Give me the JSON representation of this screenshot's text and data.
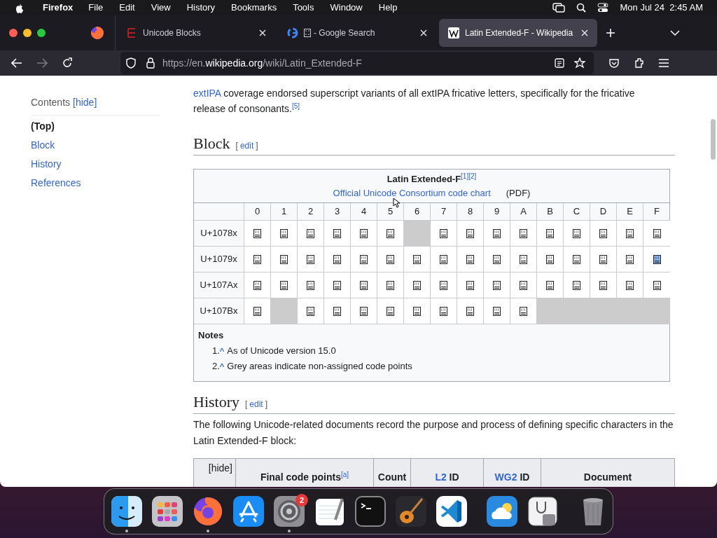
{
  "menu_bar": {
    "app": "Firefox",
    "items": [
      "File",
      "Edit",
      "View",
      "History",
      "Bookmarks",
      "Tools",
      "Window",
      "Help"
    ],
    "clock": "Mon Jul 24  2:45 AM"
  },
  "tabs": [
    {
      "title": "Unicode Blocks",
      "kind": "unicode",
      "selected": false
    },
    {
      "title": "- Google Search",
      "kind": "google",
      "selected": false
    },
    {
      "title": "Latin Extended-F - Wikipedia",
      "kind": "wikipedia",
      "selected": true
    }
  ],
  "url": {
    "scheme": "https://en.",
    "host": "wikipedia.org",
    "path": "/wiki/Latin_Extended-F"
  },
  "sidebar": {
    "title": "Contents",
    "toggle": "[hide]",
    "items": [
      {
        "label": "(Top)",
        "selected": true
      },
      {
        "label": "Block",
        "selected": false
      },
      {
        "label": "History",
        "selected": false
      },
      {
        "label": "References",
        "selected": false
      }
    ]
  },
  "intro": {
    "paragraph": [
      {
        "text": "extIPA",
        "kind": "link"
      },
      {
        "text": " coverage endorsed superscript variants of all extIPA fricative letters, specifically for the fricative release of consonants.",
        "kind": "text"
      },
      {
        "text": "[5]",
        "kind": "ref"
      }
    ]
  },
  "block_section": {
    "heading": "Block",
    "edit_open": "[",
    "edit": "edit",
    "edit_close": "]",
    "table": {
      "title": "Latin Extended-F",
      "refs": [
        "[1]",
        "[2]"
      ],
      "chart_link": "Official Unicode Consortium code chart",
      "chart_format": "(PDF)",
      "columns": [
        "0",
        "1",
        "2",
        "3",
        "4",
        "5",
        "6",
        "7",
        "8",
        "9",
        "A",
        "B",
        "C",
        "D",
        "E",
        "F"
      ],
      "rows": [
        {
          "label": "U+1078x",
          "cells": [
            {
              "assigned": true
            },
            {
              "assigned": true
            },
            {
              "assigned": true
            },
            {
              "assigned": true
            },
            {
              "assigned": true
            },
            {
              "assigned": true
            },
            {
              "assigned": false
            },
            {
              "assigned": true
            },
            {
              "assigned": true
            },
            {
              "assigned": true
            },
            {
              "assigned": true
            },
            {
              "assigned": true
            },
            {
              "assigned": true
            },
            {
              "assigned": true
            },
            {
              "assigned": true
            },
            {
              "assigned": true
            }
          ]
        },
        {
          "label": "U+1079x",
          "cells": [
            {
              "assigned": true
            },
            {
              "assigned": true
            },
            {
              "assigned": true
            },
            {
              "assigned": true
            },
            {
              "assigned": true
            },
            {
              "assigned": true
            },
            {
              "assigned": true
            },
            {
              "assigned": true
            },
            {
              "assigned": true
            },
            {
              "assigned": true
            },
            {
              "assigned": true
            },
            {
              "assigned": true
            },
            {
              "assigned": true
            },
            {
              "assigned": true
            },
            {
              "assigned": true
            },
            {
              "assigned": true,
              "highlighted": true
            }
          ]
        },
        {
          "label": "U+107Ax",
          "cells": [
            {
              "assigned": true
            },
            {
              "assigned": true
            },
            {
              "assigned": true
            },
            {
              "assigned": true
            },
            {
              "assigned": true
            },
            {
              "assigned": true
            },
            {
              "assigned": true
            },
            {
              "assigned": true
            },
            {
              "assigned": true
            },
            {
              "assigned": true
            },
            {
              "assigned": true
            },
            {
              "assigned": true
            },
            {
              "assigned": true
            },
            {
              "assigned": true
            },
            {
              "assigned": true
            },
            {
              "assigned": true
            }
          ]
        },
        {
          "label": "U+107Bx",
          "cells": [
            {
              "assigned": true
            },
            {
              "assigned": false
            },
            {
              "assigned": true
            },
            {
              "assigned": true
            },
            {
              "assigned": true
            },
            {
              "assigned": true
            },
            {
              "assigned": true
            },
            {
              "assigned": true
            },
            {
              "assigned": true
            },
            {
              "assigned": true
            },
            {
              "assigned": true
            },
            {
              "assigned": false
            },
            {
              "assigned": false
            },
            {
              "assigned": false
            },
            {
              "assigned": false
            },
            {
              "assigned": false
            }
          ]
        }
      ],
      "notes_title": "Notes",
      "notes": [
        {
          "number": "1.",
          "caret": "^",
          "text": "As of Unicode version 15.0"
        },
        {
          "number": "2.",
          "caret": "^",
          "text": "Grey areas indicate non-assigned code points"
        }
      ]
    }
  },
  "history_section": {
    "heading": "History",
    "edit_open": "[",
    "edit": "edit",
    "edit_close": "]",
    "paragraph": "The following Unicode-related documents record the purpose and process of defining specific characters in the Latin Extended-F block:",
    "table_header": {
      "toggle": "[hide]",
      "final_code_points": "Final code points",
      "final_ref": "[a]",
      "count": "Count",
      "l2_link": "L2",
      "l2_rest": " ID",
      "wg2_link": "WG2",
      "wg2_rest": " ID",
      "document": "Document"
    }
  },
  "dock": [
    {
      "kind": "finder",
      "running": true
    },
    {
      "kind": "launchpad",
      "running": false
    },
    {
      "kind": "firefox",
      "running": true
    },
    {
      "kind": "appstore",
      "running": false
    },
    {
      "kind": "settings",
      "running": true,
      "badge": "2"
    },
    {
      "kind": "textedit",
      "running": false
    },
    {
      "kind": "terminal",
      "running": false
    },
    {
      "kind": "garageband",
      "running": false
    },
    {
      "kind": "vscode",
      "running": false
    },
    {
      "kind": "separator"
    },
    {
      "kind": "weather",
      "running": false
    },
    {
      "kind": "diskutility",
      "running": false
    },
    {
      "kind": "separator"
    },
    {
      "kind": "trash",
      "running": false
    }
  ]
}
